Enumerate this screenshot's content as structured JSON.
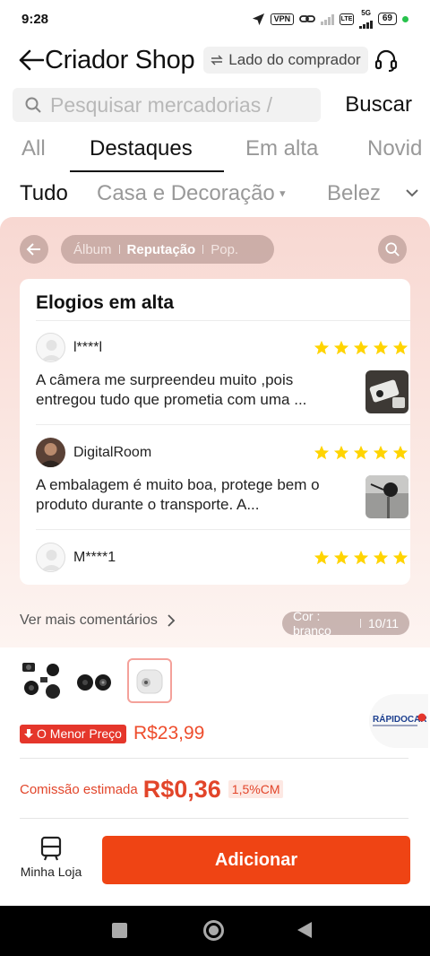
{
  "status_bar": {
    "time": "9:28",
    "vpn": "VPN",
    "network": "5G",
    "lte": "LTE",
    "battery": "69"
  },
  "header": {
    "title": "Criador Shop",
    "buyer_side_label": "Lado do comprador",
    "icons": [
      "back-arrow-icon",
      "swap-icon",
      "headset-icon"
    ]
  },
  "search": {
    "placeholder": "Pesquisar mercadorias /",
    "button_label": "Buscar"
  },
  "tabs": [
    "All",
    "Destaques",
    "Em alta",
    "Novid"
  ],
  "active_tab": "Destaques",
  "subcategories": [
    "Tudo",
    "Casa e Decoração",
    "Belez"
  ],
  "active_subcategory": "Tudo",
  "review_nav": {
    "segments": [
      "Álbum",
      "Reputação",
      "Pop."
    ],
    "active_segment": "Reputação"
  },
  "reviews_card": {
    "title": "Elogios em alta",
    "reviews": [
      {
        "name": "l****l",
        "stars": 5,
        "text": "A câmera me surpreendeu muito ,pois entregou tudo que prometia com uma ..."
      },
      {
        "name": "DigitalRoom",
        "stars": 5,
        "text": "A embalagem é muito boa, protege bem o produto durante o transporte. A..."
      },
      {
        "name": "M****1",
        "stars": 5,
        "text": ""
      }
    ]
  },
  "more_comments_label": "Ver mais comentários",
  "color_variant": {
    "label": "Cor : branco",
    "position": "10/11"
  },
  "brand_logo_text": "RÁPIDOCAR",
  "price": {
    "badge": "O Menor Preço",
    "value": "R$23,99"
  },
  "commission": {
    "label": "Comissão estimada",
    "value": "R$0,36",
    "rate": "1,5%CM"
  },
  "bottom_bar": {
    "my_store_label": "Minha Loja",
    "add_button_label": "Adicionar"
  },
  "colors": {
    "accent": "#ef4414",
    "price": "#ee4d2d",
    "badge": "#e5362b",
    "star": "#ffd400"
  }
}
